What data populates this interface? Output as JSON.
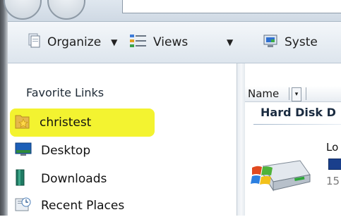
{
  "toolbar": {
    "organize_label": "Organize",
    "views_label": "Views",
    "system_label": "Syste"
  },
  "nav": {
    "heading": "Favorite Links",
    "items": [
      {
        "label": "christest",
        "icon": "favorite-folder-icon"
      },
      {
        "label": "Desktop",
        "icon": "desktop-icon"
      },
      {
        "label": "Downloads",
        "icon": "downloads-icon"
      },
      {
        "label": "Recent Places",
        "icon": "recent-places-icon"
      }
    ]
  },
  "content": {
    "column_name": "Name",
    "group_title": "Hard Disk D",
    "drive_label": "Lo",
    "drive_free": "15"
  },
  "colors": {
    "highlight": "#f2f21a",
    "drive_usage": "#1a3f8c"
  }
}
